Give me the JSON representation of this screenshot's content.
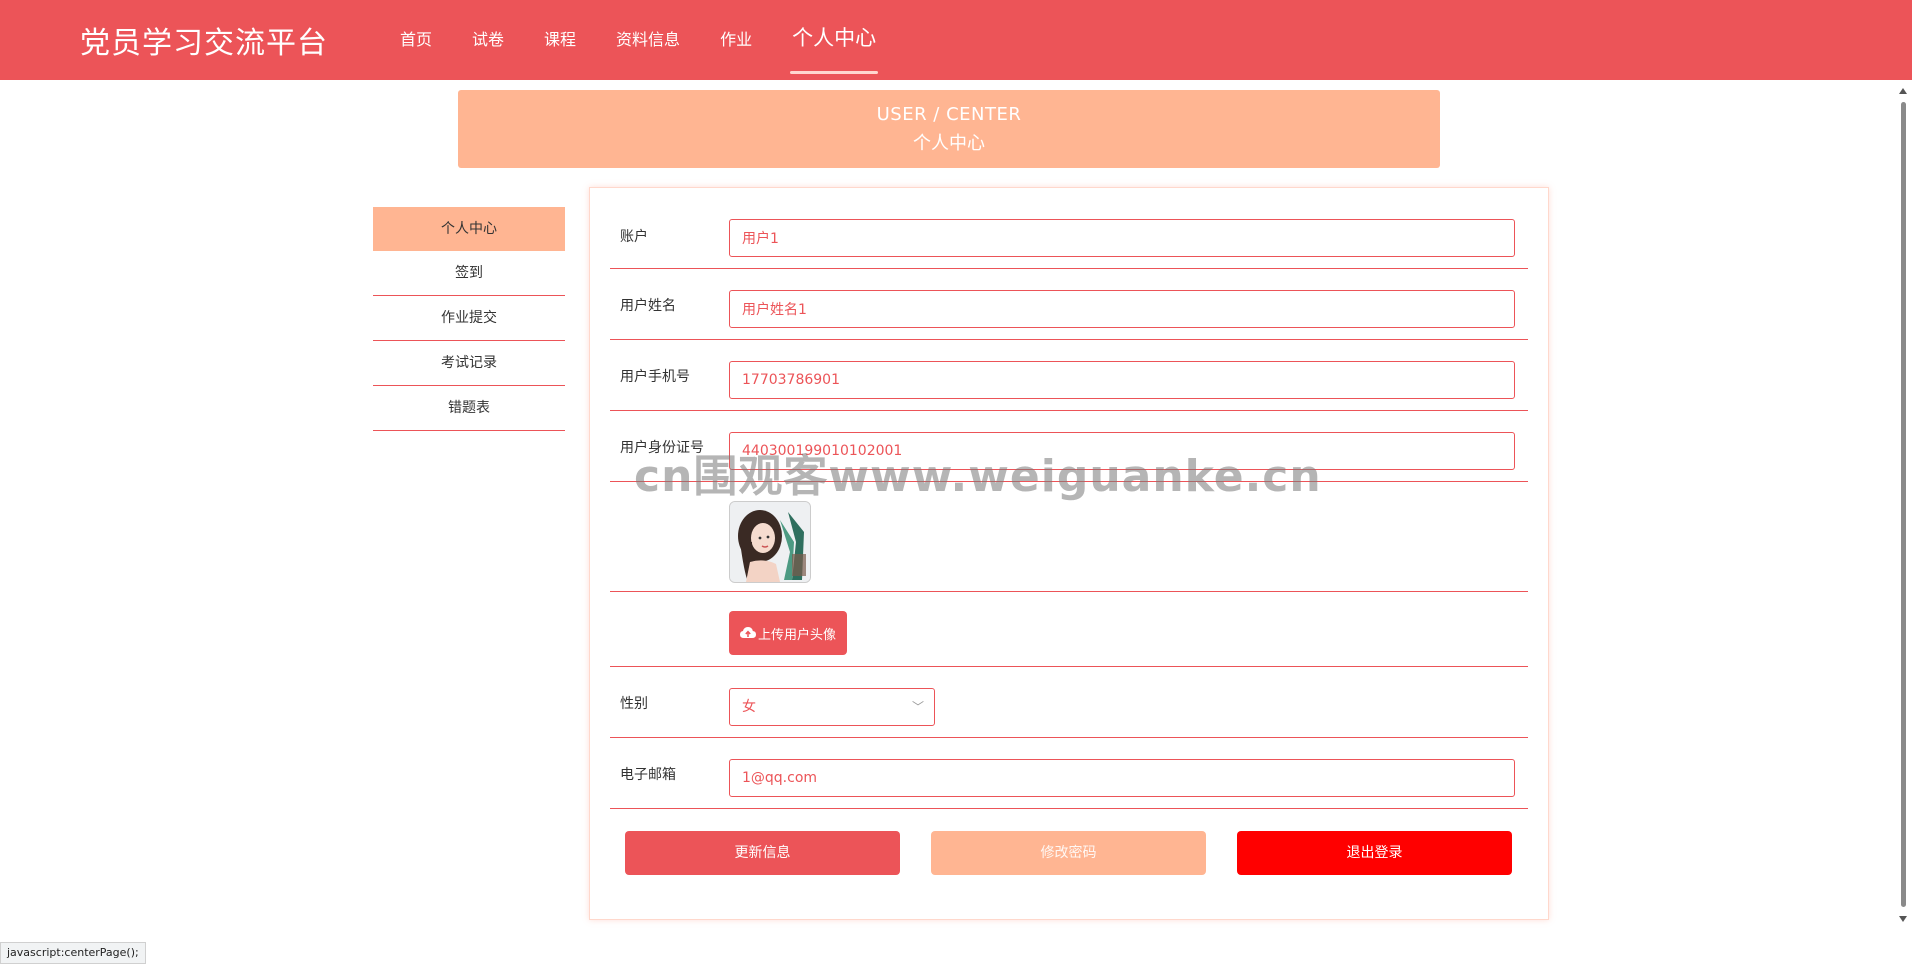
{
  "header": {
    "brand": "党员学习交流平台",
    "nav": [
      "首页",
      "试卷",
      "课程",
      "资料信息",
      "作业",
      "个人中心"
    ],
    "active_nav": "个人中心"
  },
  "banner": {
    "en": "USER / CENTER",
    "cn": "个人中心"
  },
  "sidebar": {
    "items": [
      "个人中心",
      "签到",
      "作业提交",
      "考试记录",
      "错题表"
    ],
    "active": "个人中心"
  },
  "form": {
    "account_label": "账户",
    "account_value": "用户1",
    "name_label": "用户姓名",
    "name_value": "用户姓名1",
    "phone_label": "用户手机号",
    "phone_value": "17703786901",
    "idcard_label": "用户身份证号",
    "idcard_value": "440300199010102001",
    "upload_label": "上传用户头像",
    "gender_label": "性别",
    "gender_value": "女",
    "email_label": "电子邮箱",
    "email_value": "1@qq.com"
  },
  "buttons": {
    "update": "更新信息",
    "password": "修改密码",
    "logout": "退出登录"
  },
  "watermark": "cn围观客www.weiguanke.cn",
  "statusbar": "javascript:centerPage();",
  "colors": {
    "primary": "#ec5458",
    "accent": "#ffb592",
    "danger": "#ff0000"
  }
}
